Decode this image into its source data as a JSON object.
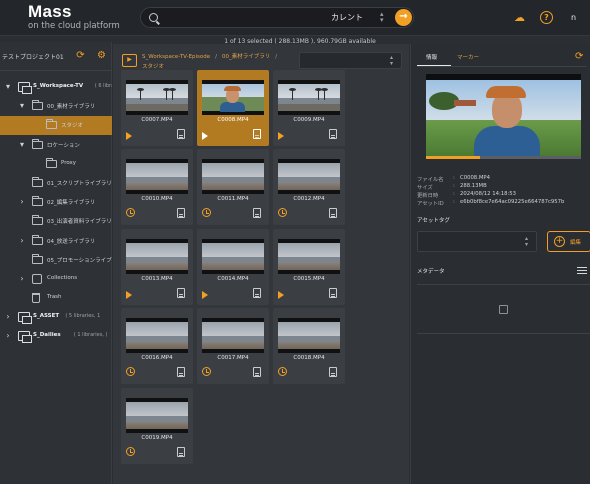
{
  "header": {
    "title": "Mass",
    "subtitle": "on the cloud platform",
    "search_placeholder": "",
    "scope": "カレント",
    "user_initial": "n"
  },
  "status": "1 of 13 selected ( 288.13MB ), 960.79GB available",
  "sidebar": {
    "project_label": "テストプロジェクト01",
    "tree": [
      {
        "label": "S_Workspace-TV",
        "meta": "( 6 libraries, 7",
        "type": "workspace",
        "caret": "▾",
        "bold": true
      },
      {
        "label": "00_素材ライブラリ",
        "type": "folder",
        "caret": "▾"
      },
      {
        "label": "スタジオ",
        "type": "folder",
        "caret": "",
        "selected": true
      },
      {
        "label": "ロケーション",
        "type": "folder",
        "caret": "▾"
      },
      {
        "label": "Proxy",
        "type": "folder",
        "caret": ""
      },
      {
        "label": "01_スクリプトライブラリ",
        "type": "folder",
        "caret": ""
      },
      {
        "label": "02_編集ライブラリ",
        "type": "folder",
        "caret": "›"
      },
      {
        "label": "03_出演者資料ライブラリ",
        "type": "folder",
        "caret": ""
      },
      {
        "label": "04_放送ライブラリ",
        "type": "folder",
        "caret": "›"
      },
      {
        "label": "05_プロモーションライブラリ",
        "type": "folder",
        "caret": ""
      },
      {
        "label": "Collections",
        "type": "collections",
        "caret": "›"
      },
      {
        "label": "Trash",
        "type": "trash",
        "caret": ""
      },
      {
        "label": "S_ASSET",
        "meta": "( 5 libraries, 1",
        "type": "workspace",
        "caret": "›",
        "bold": true
      },
      {
        "label": "S_Dailies",
        "meta": "( 1 libraries, (",
        "type": "workspace",
        "caret": "›",
        "bold": true
      }
    ]
  },
  "breadcrumb": {
    "line1": [
      "S_Workspace-TV-Episode",
      "00_素材ライブラリ",
      ""
    ],
    "line2": "スタジオ",
    "icon": "video-folder-icon"
  },
  "assets": [
    {
      "name": "C0007.MP4",
      "style": "palms",
      "action": "play"
    },
    {
      "name": "C0008.MP4",
      "style": "face",
      "action": "play",
      "selected": true
    },
    {
      "name": "C0009.MP4",
      "style": "palms",
      "action": "play"
    },
    {
      "name": "C0010.MP4",
      "style": "beach",
      "action": "proxy"
    },
    {
      "name": "C0011.MP4",
      "style": "beach",
      "action": "proxy"
    },
    {
      "name": "C0012.MP4",
      "style": "beach",
      "action": "proxy"
    },
    {
      "name": "C0013.MP4",
      "style": "beach",
      "action": "play"
    },
    {
      "name": "C0014.MP4",
      "style": "beach",
      "action": "play"
    },
    {
      "name": "C0015.MP4",
      "style": "beach",
      "action": "play"
    },
    {
      "name": "C0016.MP4",
      "style": "beach",
      "action": "proxy"
    },
    {
      "name": "C0017.MP4",
      "style": "beach",
      "action": "proxy"
    },
    {
      "name": "C0018.MP4",
      "style": "beach",
      "action": "proxy"
    },
    {
      "name": "C0019.MP4",
      "style": "beach",
      "action": "proxy"
    }
  ],
  "details": {
    "tabs": [
      "情報",
      "マーカー"
    ],
    "playback_progress": 0.35,
    "meta": [
      {
        "key": "ファイル名",
        "value": "C0008.MP4"
      },
      {
        "key": "サイズ",
        "value": "288.13MB"
      },
      {
        "key": "更新日時",
        "value": "2024/08/12 14:18:53"
      },
      {
        "key": "アセットID",
        "value": "e6b0bf8ce7e64ac09225e664787c957b"
      }
    ],
    "asset_tag_title": "アセットタグ",
    "edit_label": "編集",
    "metadata_title": "メタデータ"
  },
  "colors": {
    "accent": "#f2a025",
    "selected": "#b27a21"
  }
}
